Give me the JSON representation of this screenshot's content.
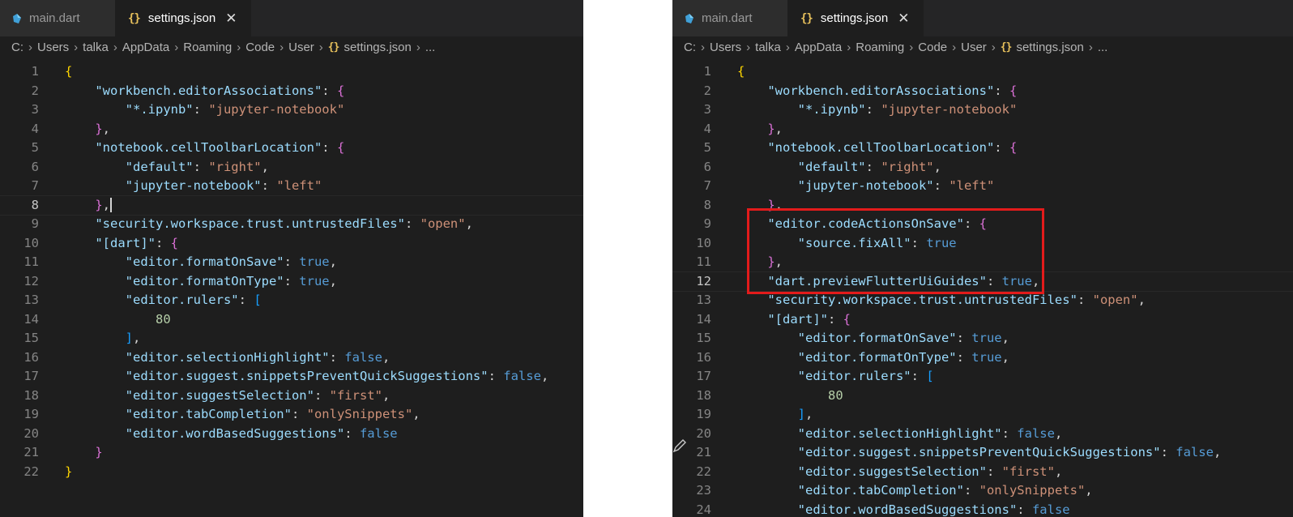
{
  "left": {
    "tabs": [
      {
        "label": "main.dart",
        "icon": "dart-icon",
        "active": false
      },
      {
        "label": "settings.json",
        "icon": "json-icon",
        "active": true
      }
    ],
    "breadcrumb": [
      "C:",
      "Users",
      "talka",
      "AppData",
      "Roaming",
      "Code",
      "User",
      "settings.json",
      "..."
    ],
    "current_line": 8,
    "lines": [
      [
        [
          "br1",
          "{"
        ]
      ],
      [
        [
          "k",
          "    \"workbench.editorAssociations\""
        ],
        [
          "p",
          ": "
        ],
        [
          "br2",
          "{"
        ]
      ],
      [
        [
          "k",
          "        \"*.ipynb\""
        ],
        [
          "p",
          ": "
        ],
        [
          "s",
          "\"jupyter-notebook\""
        ]
      ],
      [
        [
          "br2",
          "    }"
        ],
        [
          "p",
          ","
        ]
      ],
      [
        [
          "k",
          "    \"notebook.cellToolbarLocation\""
        ],
        [
          "p",
          ": "
        ],
        [
          "br2",
          "{"
        ]
      ],
      [
        [
          "k",
          "        \"default\""
        ],
        [
          "p",
          ": "
        ],
        [
          "s",
          "\"right\""
        ],
        [
          "p",
          ","
        ]
      ],
      [
        [
          "k",
          "        \"jupyter-notebook\""
        ],
        [
          "p",
          ": "
        ],
        [
          "s",
          "\"left\""
        ]
      ],
      [
        [
          "br2",
          "    }"
        ],
        [
          "p",
          ","
        ]
      ],
      [
        [
          "k",
          "    \"security.workspace.trust.untrustedFiles\""
        ],
        [
          "p",
          ": "
        ],
        [
          "s",
          "\"open\""
        ],
        [
          "p",
          ","
        ]
      ],
      [
        [
          "k",
          "    \"[dart]\""
        ],
        [
          "p",
          ": "
        ],
        [
          "br2",
          "{"
        ]
      ],
      [
        [
          "k",
          "        \"editor.formatOnSave\""
        ],
        [
          "p",
          ": "
        ],
        [
          "b",
          "true"
        ],
        [
          "p",
          ","
        ]
      ],
      [
        [
          "k",
          "        \"editor.formatOnType\""
        ],
        [
          "p",
          ": "
        ],
        [
          "b",
          "true"
        ],
        [
          "p",
          ","
        ]
      ],
      [
        [
          "k",
          "        \"editor.rulers\""
        ],
        [
          "p",
          ": "
        ],
        [
          "br3",
          "["
        ]
      ],
      [
        [
          "n",
          "            80"
        ]
      ],
      [
        [
          "br3",
          "        ]"
        ],
        [
          "p",
          ","
        ]
      ],
      [
        [
          "k",
          "        \"editor.selectionHighlight\""
        ],
        [
          "p",
          ": "
        ],
        [
          "b",
          "false"
        ],
        [
          "p",
          ","
        ]
      ],
      [
        [
          "k",
          "        \"editor.suggest.snippetsPreventQuickSuggestions\""
        ],
        [
          "p",
          ": "
        ],
        [
          "b",
          "false"
        ],
        [
          "p",
          ","
        ]
      ],
      [
        [
          "k",
          "        \"editor.suggestSelection\""
        ],
        [
          "p",
          ": "
        ],
        [
          "s",
          "\"first\""
        ],
        [
          "p",
          ","
        ]
      ],
      [
        [
          "k",
          "        \"editor.tabCompletion\""
        ],
        [
          "p",
          ": "
        ],
        [
          "s",
          "\"onlySnippets\""
        ],
        [
          "p",
          ","
        ]
      ],
      [
        [
          "k",
          "        \"editor.wordBasedSuggestions\""
        ],
        [
          "p",
          ": "
        ],
        [
          "b",
          "false"
        ]
      ],
      [
        [
          "br2",
          "    }"
        ]
      ],
      [
        [
          "br1",
          "}"
        ]
      ]
    ]
  },
  "right": {
    "tabs": [
      {
        "label": "main.dart",
        "icon": "dart-icon",
        "active": false
      },
      {
        "label": "settings.json",
        "icon": "json-icon",
        "active": true
      }
    ],
    "breadcrumb": [
      "C:",
      "Users",
      "talka",
      "AppData",
      "Roaming",
      "Code",
      "User",
      "settings.json",
      "..."
    ],
    "current_line": 12,
    "highlight_lines": [
      9,
      12
    ],
    "lines": [
      [
        [
          "br1",
          "{"
        ]
      ],
      [
        [
          "k",
          "    \"workbench.editorAssociations\""
        ],
        [
          "p",
          ": "
        ],
        [
          "br2",
          "{"
        ]
      ],
      [
        [
          "k",
          "        \"*.ipynb\""
        ],
        [
          "p",
          ": "
        ],
        [
          "s",
          "\"jupyter-notebook\""
        ]
      ],
      [
        [
          "br2",
          "    }"
        ],
        [
          "p",
          ","
        ]
      ],
      [
        [
          "k",
          "    \"notebook.cellToolbarLocation\""
        ],
        [
          "p",
          ": "
        ],
        [
          "br2",
          "{"
        ]
      ],
      [
        [
          "k",
          "        \"default\""
        ],
        [
          "p",
          ": "
        ],
        [
          "s",
          "\"right\""
        ],
        [
          "p",
          ","
        ]
      ],
      [
        [
          "k",
          "        \"jupyter-notebook\""
        ],
        [
          "p",
          ": "
        ],
        [
          "s",
          "\"left\""
        ]
      ],
      [
        [
          "br2",
          "    }"
        ],
        [
          "p",
          ","
        ]
      ],
      [
        [
          "k",
          "    \"editor.codeActionsOnSave\""
        ],
        [
          "p",
          ": "
        ],
        [
          "br2",
          "{"
        ]
      ],
      [
        [
          "k",
          "        \"source.fixAll\""
        ],
        [
          "p",
          ": "
        ],
        [
          "b",
          "true"
        ]
      ],
      [
        [
          "br2",
          "    }"
        ],
        [
          "p",
          ","
        ]
      ],
      [
        [
          "k",
          "    \"dart.previewFlutterUiGuides\""
        ],
        [
          "p",
          ": "
        ],
        [
          "b",
          "true"
        ],
        [
          "p",
          ","
        ]
      ],
      [
        [
          "k",
          "    \"security.workspace.trust.untrustedFiles\""
        ],
        [
          "p",
          ": "
        ],
        [
          "s",
          "\"open\""
        ],
        [
          "p",
          ","
        ]
      ],
      [
        [
          "k",
          "    \"[dart]\""
        ],
        [
          "p",
          ": "
        ],
        [
          "br2",
          "{"
        ]
      ],
      [
        [
          "k",
          "        \"editor.formatOnSave\""
        ],
        [
          "p",
          ": "
        ],
        [
          "b",
          "true"
        ],
        [
          "p",
          ","
        ]
      ],
      [
        [
          "k",
          "        \"editor.formatOnType\""
        ],
        [
          "p",
          ": "
        ],
        [
          "b",
          "true"
        ],
        [
          "p",
          ","
        ]
      ],
      [
        [
          "k",
          "        \"editor.rulers\""
        ],
        [
          "p",
          ": "
        ],
        [
          "br3",
          "["
        ]
      ],
      [
        [
          "n",
          "            80"
        ]
      ],
      [
        [
          "br3",
          "        ]"
        ],
        [
          "p",
          ","
        ]
      ],
      [
        [
          "k",
          "        \"editor.selectionHighlight\""
        ],
        [
          "p",
          ": "
        ],
        [
          "b",
          "false"
        ],
        [
          "p",
          ","
        ]
      ],
      [
        [
          "k",
          "        \"editor.suggest.snippetsPreventQuickSuggestions\""
        ],
        [
          "p",
          ": "
        ],
        [
          "b",
          "false"
        ],
        [
          "p",
          ","
        ]
      ],
      [
        [
          "k",
          "        \"editor.suggestSelection\""
        ],
        [
          "p",
          ": "
        ],
        [
          "s",
          "\"first\""
        ],
        [
          "p",
          ","
        ]
      ],
      [
        [
          "k",
          "        \"editor.tabCompletion\""
        ],
        [
          "p",
          ": "
        ],
        [
          "s",
          "\"onlySnippets\""
        ],
        [
          "p",
          ","
        ]
      ],
      [
        [
          "k",
          "        \"editor.wordBasedSuggestions\""
        ],
        [
          "p",
          ": "
        ],
        [
          "b",
          "false"
        ]
      ]
    ]
  },
  "colors": {
    "editor_bg": "#1e1e1e",
    "key": "#9cdcfe",
    "string": "#ce9178",
    "boolean": "#569cd6",
    "number": "#b5cea8",
    "highlight_box": "#e31b1b"
  }
}
